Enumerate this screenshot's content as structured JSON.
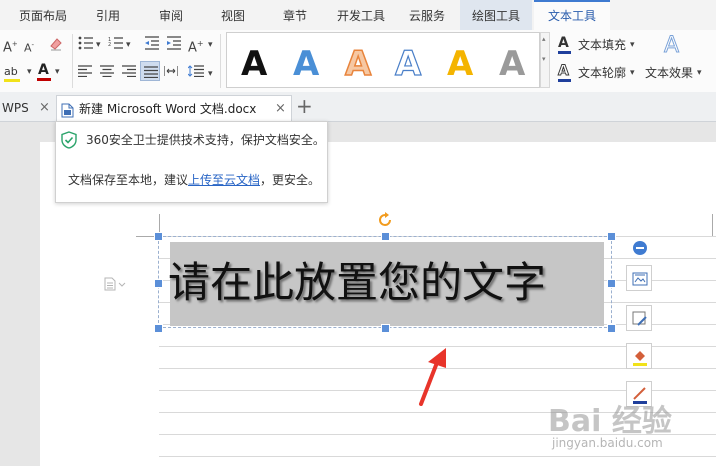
{
  "menu": {
    "tabs": [
      {
        "label": "页面布局"
      },
      {
        "label": "引用"
      },
      {
        "label": "审阅"
      },
      {
        "label": "视图"
      },
      {
        "label": "章节"
      },
      {
        "label": "开发工具"
      },
      {
        "label": "云服务"
      },
      {
        "label": "绘图工具"
      },
      {
        "label": "文本工具"
      }
    ],
    "active_tab": "文本工具"
  },
  "ribbon": {
    "text_fill_label": "文本填充",
    "text_outline_label": "文本轮廓",
    "text_effect_label": "文本效果",
    "art_preview_char": "A",
    "gallery_colors": [
      "#111111",
      "#4a8fd6",
      "#e8843c",
      "#ffffff",
      "#f4b400",
      "#9a9a9a"
    ],
    "highlight_color": "#f1e21a",
    "font_color": "#c00000"
  },
  "tabbar": {
    "prev_tab_label": "WPS",
    "active_tab_label": "新建 Microsoft Word 文档.docx",
    "close_symbol": "×",
    "add_symbol": "+"
  },
  "popup": {
    "security_message": "360安全卫士提供技术支持，保护文档安全。",
    "save_prefix": "文档保存至本地，建议",
    "save_link": "上传至云文档",
    "save_suffix": "，更安全。"
  },
  "document": {
    "textbox_text": "请在此放置您的文字"
  },
  "watermark": {
    "logo_text": "Bai 经验",
    "url": "jingyan.baidu.com"
  }
}
